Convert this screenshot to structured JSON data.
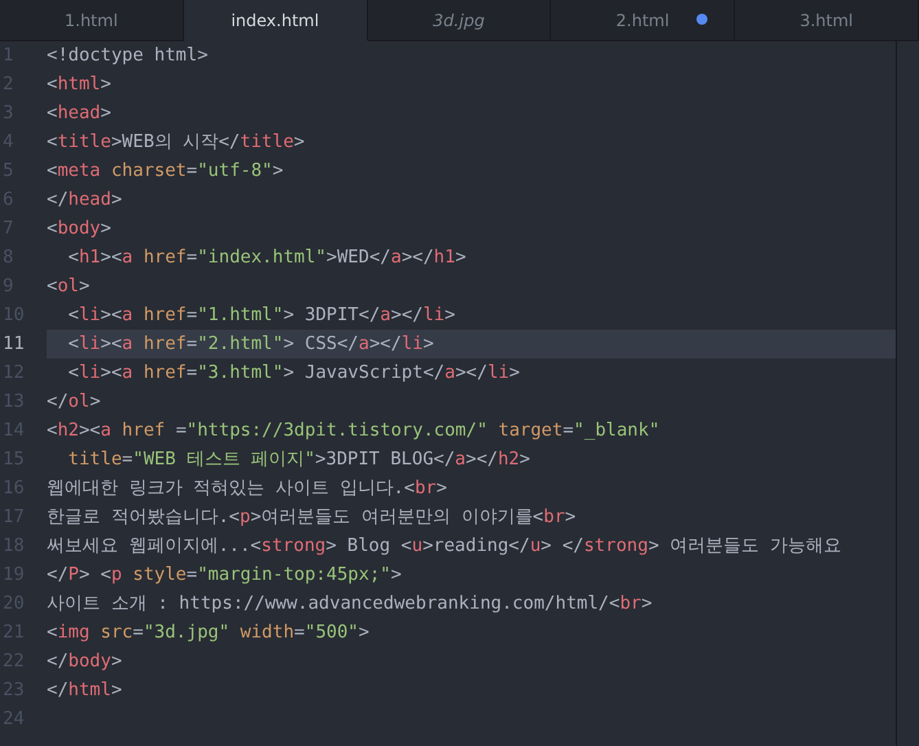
{
  "tabs": [
    {
      "label": "1.html",
      "selected": false,
      "kind": "file",
      "modified": false
    },
    {
      "label": "index.html",
      "selected": true,
      "kind": "file",
      "modified": false
    },
    {
      "label": "3d.jpg",
      "selected": false,
      "kind": "preview",
      "modified": false
    },
    {
      "label": "2.html",
      "selected": false,
      "kind": "file",
      "modified": true
    },
    {
      "label": "3.html",
      "selected": false,
      "kind": "file",
      "modified": false
    }
  ],
  "lines": [
    {
      "number": "1",
      "current": false,
      "tokens": [
        {
          "kind": "punct",
          "text": "<!doctype html>"
        }
      ]
    },
    {
      "number": "2",
      "current": false,
      "tokens": [
        {
          "kind": "punct",
          "text": "<"
        },
        {
          "kind": "tag",
          "text": "html"
        },
        {
          "kind": "punct",
          "text": ">"
        }
      ]
    },
    {
      "number": "3",
      "current": false,
      "tokens": [
        {
          "kind": "punct",
          "text": "<"
        },
        {
          "kind": "tag",
          "text": "head"
        },
        {
          "kind": "punct",
          "text": ">"
        }
      ]
    },
    {
      "number": "4",
      "current": false,
      "tokens": [
        {
          "kind": "punct",
          "text": "<"
        },
        {
          "kind": "tag",
          "text": "title"
        },
        {
          "kind": "punct",
          "text": ">WEB의 시작</"
        },
        {
          "kind": "tag",
          "text": "title"
        },
        {
          "kind": "punct",
          "text": ">"
        }
      ]
    },
    {
      "number": "5",
      "current": false,
      "tokens": [
        {
          "kind": "punct",
          "text": "<"
        },
        {
          "kind": "tag",
          "text": "meta"
        },
        {
          "kind": "attr",
          "text": " charset"
        },
        {
          "kind": "punct",
          "text": "="
        },
        {
          "kind": "string",
          "text": "\"utf-8\""
        },
        {
          "kind": "punct",
          "text": ">"
        }
      ]
    },
    {
      "number": "6",
      "current": false,
      "tokens": [
        {
          "kind": "punct",
          "text": "</"
        },
        {
          "kind": "tag",
          "text": "head"
        },
        {
          "kind": "punct",
          "text": ">"
        }
      ]
    },
    {
      "number": "7",
      "current": false,
      "tokens": [
        {
          "kind": "punct",
          "text": "<"
        },
        {
          "kind": "tag",
          "text": "body"
        },
        {
          "kind": "punct",
          "text": ">"
        }
      ]
    },
    {
      "number": "8",
      "current": false,
      "tokens": [
        {
          "kind": "punct",
          "text": "  <"
        },
        {
          "kind": "tag",
          "text": "h1"
        },
        {
          "kind": "punct",
          "text": "><"
        },
        {
          "kind": "tag",
          "text": "a"
        },
        {
          "kind": "attr",
          "text": " href"
        },
        {
          "kind": "punct",
          "text": "="
        },
        {
          "kind": "string",
          "text": "\"index.html\""
        },
        {
          "kind": "punct",
          "text": ">WED</"
        },
        {
          "kind": "tag",
          "text": "a"
        },
        {
          "kind": "punct",
          "text": "></"
        },
        {
          "kind": "tag",
          "text": "h1"
        },
        {
          "kind": "punct",
          "text": ">"
        }
      ]
    },
    {
      "number": "9",
      "current": false,
      "tokens": [
        {
          "kind": "punct",
          "text": "<"
        },
        {
          "kind": "tag",
          "text": "ol"
        },
        {
          "kind": "punct",
          "text": ">"
        }
      ]
    },
    {
      "number": "10",
      "current": false,
      "tokens": [
        {
          "kind": "punct",
          "text": "  <"
        },
        {
          "kind": "tag",
          "text": "li"
        },
        {
          "kind": "punct",
          "text": "><"
        },
        {
          "kind": "tag",
          "text": "a"
        },
        {
          "kind": "attr",
          "text": " href"
        },
        {
          "kind": "punct",
          "text": "="
        },
        {
          "kind": "string",
          "text": "\"1.html\""
        },
        {
          "kind": "punct",
          "text": "> 3DPIT</"
        },
        {
          "kind": "tag",
          "text": "a"
        },
        {
          "kind": "punct",
          "text": "></"
        },
        {
          "kind": "tag",
          "text": "li"
        },
        {
          "kind": "punct",
          "text": ">"
        }
      ]
    },
    {
      "number": "11",
      "current": true,
      "tokens": [
        {
          "kind": "punct",
          "text": "  <"
        },
        {
          "kind": "tag",
          "text": "li"
        },
        {
          "kind": "punct",
          "text": "><"
        },
        {
          "kind": "tag",
          "text": "a"
        },
        {
          "kind": "attr",
          "text": " href"
        },
        {
          "kind": "punct",
          "text": "="
        },
        {
          "kind": "string",
          "text": "\"2.html\""
        },
        {
          "kind": "punct",
          "text": "> CSS</"
        },
        {
          "kind": "tag",
          "text": "a"
        },
        {
          "kind": "punct",
          "text": "></"
        },
        {
          "kind": "tag",
          "text": "li"
        },
        {
          "kind": "punct",
          "text": ">"
        }
      ]
    },
    {
      "number": "12",
      "current": false,
      "tokens": [
        {
          "kind": "punct",
          "text": "  <"
        },
        {
          "kind": "tag",
          "text": "li"
        },
        {
          "kind": "punct",
          "text": "><"
        },
        {
          "kind": "tag",
          "text": "a"
        },
        {
          "kind": "attr",
          "text": " href"
        },
        {
          "kind": "punct",
          "text": "="
        },
        {
          "kind": "string",
          "text": "\"3.html\""
        },
        {
          "kind": "punct",
          "text": "> JavavScript</"
        },
        {
          "kind": "tag",
          "text": "a"
        },
        {
          "kind": "punct",
          "text": "></"
        },
        {
          "kind": "tag",
          "text": "li"
        },
        {
          "kind": "punct",
          "text": ">"
        }
      ]
    },
    {
      "number": "13",
      "current": false,
      "tokens": [
        {
          "kind": "punct",
          "text": "</"
        },
        {
          "kind": "tag",
          "text": "ol"
        },
        {
          "kind": "punct",
          "text": ">"
        }
      ]
    },
    {
      "number": "14",
      "current": false,
      "tokens": [
        {
          "kind": "punct",
          "text": "<"
        },
        {
          "kind": "tag",
          "text": "h2"
        },
        {
          "kind": "punct",
          "text": "><"
        },
        {
          "kind": "tag",
          "text": "a"
        },
        {
          "kind": "attr",
          "text": " href "
        },
        {
          "kind": "punct",
          "text": "="
        },
        {
          "kind": "string",
          "text": "\"https://3dpit.tistory.com/\""
        },
        {
          "kind": "attr",
          "text": " target"
        },
        {
          "kind": "punct",
          "text": "="
        },
        {
          "kind": "string",
          "text": "\"_blank\""
        }
      ]
    },
    {
      "number": "15",
      "current": false,
      "tokens": [
        {
          "kind": "attr",
          "text": "  title"
        },
        {
          "kind": "punct",
          "text": "="
        },
        {
          "kind": "string",
          "text": "\"WEB 테스트 페이지\""
        },
        {
          "kind": "punct",
          "text": ">3DPIT BLOG</"
        },
        {
          "kind": "tag",
          "text": "a"
        },
        {
          "kind": "punct",
          "text": "></"
        },
        {
          "kind": "tag",
          "text": "h2"
        },
        {
          "kind": "punct",
          "text": ">"
        }
      ]
    },
    {
      "number": "16",
      "current": false,
      "tokens": [
        {
          "kind": "punct",
          "text": "웹에대한 링크가 적혀있는 사이트 입니다.<"
        },
        {
          "kind": "tag",
          "text": "br"
        },
        {
          "kind": "punct",
          "text": ">"
        }
      ]
    },
    {
      "number": "17",
      "current": false,
      "tokens": [
        {
          "kind": "punct",
          "text": "한글로 적어봤습니다.<"
        },
        {
          "kind": "tag",
          "text": "p"
        },
        {
          "kind": "punct",
          "text": ">여러분들도 여러분만의 이야기를<"
        },
        {
          "kind": "tag",
          "text": "br"
        },
        {
          "kind": "punct",
          "text": ">"
        }
      ]
    },
    {
      "number": "18",
      "current": false,
      "tokens": [
        {
          "kind": "punct",
          "text": "써보세요 웹페이지에...<"
        },
        {
          "kind": "tag",
          "text": "strong"
        },
        {
          "kind": "punct",
          "text": "> Blog <"
        },
        {
          "kind": "tag",
          "text": "u"
        },
        {
          "kind": "punct",
          "text": ">reading</"
        },
        {
          "kind": "tag",
          "text": "u"
        },
        {
          "kind": "punct",
          "text": "> </"
        },
        {
          "kind": "tag",
          "text": "strong"
        },
        {
          "kind": "punct",
          "text": "> 여러분들도 가능해요"
        }
      ]
    },
    {
      "number": "19",
      "current": false,
      "tokens": [
        {
          "kind": "punct",
          "text": "</"
        },
        {
          "kind": "tag",
          "text": "P"
        },
        {
          "kind": "punct",
          "text": "> <"
        },
        {
          "kind": "tag",
          "text": "p"
        },
        {
          "kind": "attr",
          "text": " style"
        },
        {
          "kind": "punct",
          "text": "="
        },
        {
          "kind": "string",
          "text": "\"margin-top:45px;\""
        },
        {
          "kind": "punct",
          "text": ">"
        }
      ]
    },
    {
      "number": "20",
      "current": false,
      "tokens": [
        {
          "kind": "punct",
          "text": "사이트 소개 : https://www.advancedwebranking.com/html/<"
        },
        {
          "kind": "tag",
          "text": "br"
        },
        {
          "kind": "punct",
          "text": ">"
        }
      ]
    },
    {
      "number": "21",
      "current": false,
      "tokens": [
        {
          "kind": "punct",
          "text": "<"
        },
        {
          "kind": "tag",
          "text": "img"
        },
        {
          "kind": "attr",
          "text": " src"
        },
        {
          "kind": "punct",
          "text": "="
        },
        {
          "kind": "string",
          "text": "\"3d.jpg\""
        },
        {
          "kind": "attr",
          "text": " width"
        },
        {
          "kind": "punct",
          "text": "="
        },
        {
          "kind": "string",
          "text": "\"500\""
        },
        {
          "kind": "punct",
          "text": ">"
        }
      ]
    },
    {
      "number": "22",
      "current": false,
      "tokens": [
        {
          "kind": "punct",
          "text": "</"
        },
        {
          "kind": "tag",
          "text": "body"
        },
        {
          "kind": "punct",
          "text": ">"
        }
      ]
    },
    {
      "number": "23",
      "current": false,
      "tokens": [
        {
          "kind": "punct",
          "text": "</"
        },
        {
          "kind": "tag",
          "text": "html"
        },
        {
          "kind": "punct",
          "text": ">"
        }
      ]
    },
    {
      "number": "24",
      "current": false
    }
  ]
}
